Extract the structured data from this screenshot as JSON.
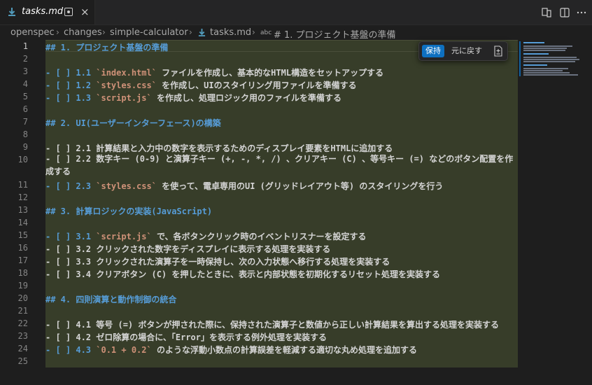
{
  "tab": {
    "title": "tasks.md",
    "close_glyph": "×"
  },
  "toolbar_icons": [
    "open-preview-icon",
    "split-editor-icon",
    "more-actions-icon"
  ],
  "breadcrumb": {
    "items": [
      "openspec",
      "changes",
      "simple-calculator",
      "tasks.md",
      "# 1. プロジェクト基盤の準備"
    ],
    "symbol_label": "abc"
  },
  "inline_actions": {
    "keep_label": "保持",
    "undo_label": "元に戻す"
  },
  "editor": {
    "line_numbers": [
      "1",
      "2",
      "3",
      "4",
      "5",
      "6",
      "7",
      "8",
      "9",
      "10",
      "11",
      "12",
      "13",
      "14",
      "15",
      "16",
      "17",
      "18",
      "19",
      "20",
      "21",
      "22",
      "23",
      "24",
      "25"
    ],
    "lines": {
      "l1": "## 1. プロジェクト基盤の準備",
      "l3a": "- [ ] 1.1 ",
      "l3b": "`index.html`",
      "l3c": " ファイルを作成し、基本的なHTML構造をセットアップする",
      "l4a": "- [ ] 1.2 ",
      "l4b": "`styles.css`",
      "l4c": " を作成し、UIのスタイリング用ファイルを準備する",
      "l5a": "- [ ] 1.3 ",
      "l5b": "`script.js`",
      "l5c": " を作成し、処理ロジック用のファイルを準備する",
      "l7": "## 2. UI(ユーザーインターフェース)の構築",
      "l9": "- [ ] 2.1 計算結果と入力中の数字を表示するためのディスプレイ要素をHTMLに追加する",
      "l10": "- [ ] 2.2 数字キー (0-9) と演算子キー (+, -, *, /) 、クリアキー (C) 、等号キー (=) などのボタン配置を作成する",
      "l11a": "- [ ] 2.3 ",
      "l11b": "`styles.css`",
      "l11c": " を使って、電卓専用のUI (グリッドレイアウト等) のスタイリングを行う",
      "l13": "## 3. 計算ロジックの実装(JavaScript)",
      "l15a": "- [ ] 3.1 ",
      "l15b": "`script.js`",
      "l15c": " で、各ボタンクリック時のイベントリスナーを設定する",
      "l16": "- [ ] 3.2 クリックされた数字をディスプレイに表示する処理を実装する",
      "l17": "- [ ] 3.3 クリックされた演算子を一時保持し、次の入力状態へ移行する処理を実装する",
      "l18": "- [ ] 3.4 クリアボタン (C) を押したときに、表示と内部状態を初期化するリセット処理を実装する",
      "l20": "## 4. 四則演算と動作制御の統合",
      "l22": "- [ ] 4.1 等号 (=) ボタンが押された際に、保持された演算子と数値から正しい計算結果を算出する処理を実装する",
      "l23": "- [ ] 4.2 ゼロ除算の場合に、「Error」を表示する例外処理を実装する",
      "l24a": "- [ ] 4.3 ",
      "l24b": "`0.1 + 0.2`",
      "l24c": " のような浮動小数点の計算誤差を軽減する適切な丸め処理を追加する"
    }
  },
  "colors": {
    "accent": "#0e70c0",
    "heading": "#569cd6",
    "inline_code": "#ce9178",
    "diff_added_bg": "#373d29"
  }
}
